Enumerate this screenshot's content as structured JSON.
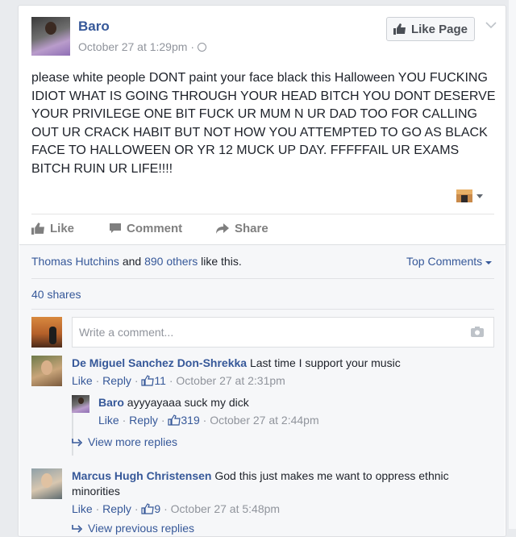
{
  "post": {
    "author": "Baro",
    "timestamp": "October 27 at 1:29pm",
    "time_sep": "·",
    "like_page_label": "Like Page",
    "text": "please white people DONT paint your face black this Halloween YOU FUCKING IDIOT WHAT IS GOING THROUGH YOUR HEAD BITCH YOU DONT DESERVE YOUR PRIVILEGE ONE BIT FUCK UR MUM N UR DAD TOO FOR CALLING OUT UR CRACK HABIT BUT NOT HOW YOU ATTEMPTED TO GO AS BLACK FACE TO HALLOWEEN OR YR 12 MUCK UP DAY. FFFFFAIL UR EXAMS BITCH RUIN UR LIFE!!!!"
  },
  "actions": {
    "like": "Like",
    "comment": "Comment",
    "share": "Share"
  },
  "summary": {
    "liker": "Thomas Hutchins",
    "and": " and ",
    "others": "890 others",
    "like_this": " like this.",
    "top_comments": "Top Comments",
    "shares": "40 shares"
  },
  "composer": {
    "placeholder": "Write a comment..."
  },
  "comments": [
    {
      "author": "De Miguel Sanchez Don-Shrekka",
      "text": "Last time I support your music",
      "like": "Like",
      "reply": "Reply",
      "likes": "11",
      "time": "October 27 at 2:31pm",
      "replies": [
        {
          "author": "Baro",
          "text": "ayyyayaaa suck my dick",
          "like": "Like",
          "reply": "Reply",
          "likes": "319",
          "time": "October 27 at 2:44pm"
        }
      ],
      "more_replies": "View more replies"
    },
    {
      "author": "Marcus Hugh Christensen",
      "text": "God this just makes me want to oppress ethnic minorities",
      "like": "Like",
      "reply": "Reply",
      "likes": "9",
      "time": "October 27 at 5:48pm",
      "more_replies": "View previous replies"
    }
  ],
  "meta_sep": " · ",
  "colors": {
    "link": "#365899",
    "muted": "#90949c",
    "text": "#1d2129",
    "background": "#e9ebee"
  }
}
